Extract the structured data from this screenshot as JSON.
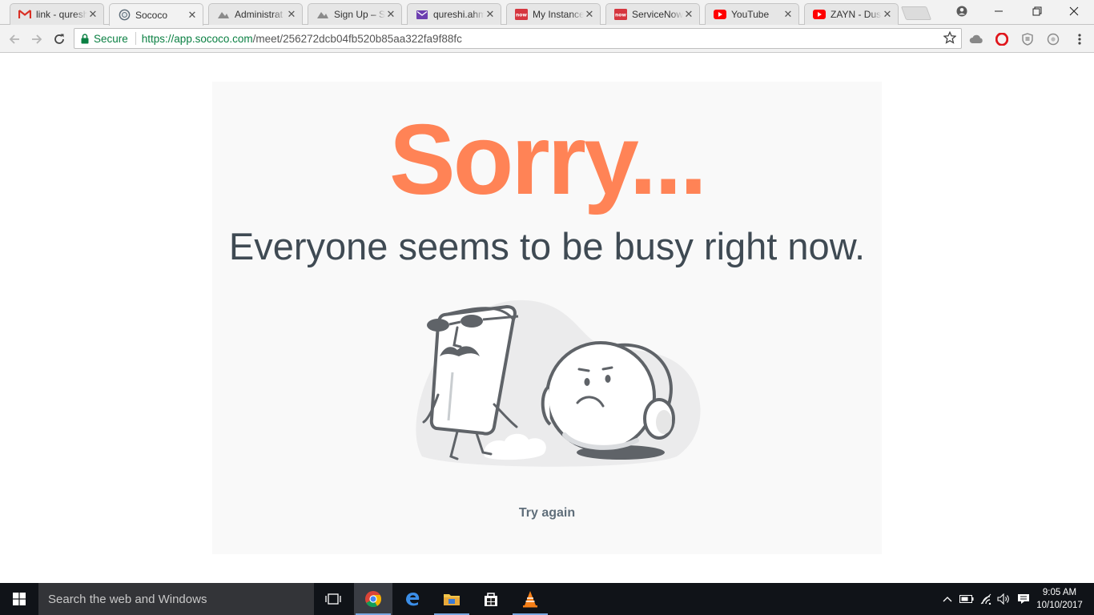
{
  "browser": {
    "tabs": [
      {
        "title": "link - quresh",
        "icon": "gmail-icon"
      },
      {
        "title": "Sococo",
        "icon": "sococo-icon",
        "active": true
      },
      {
        "title": "Administrat",
        "icon": "admin-icon"
      },
      {
        "title": "Sign Up – Sc",
        "icon": "signup-icon"
      },
      {
        "title": "qureshi.ahm",
        "icon": "mail-icon"
      },
      {
        "title": "My Instance",
        "icon": "servicenow-icon"
      },
      {
        "title": "ServiceNow",
        "icon": "servicenow-icon"
      },
      {
        "title": "YouTube",
        "icon": "youtube-icon"
      },
      {
        "title": "ZAYN - Dus",
        "icon": "youtube-icon"
      }
    ],
    "close_glyph": "✕",
    "secure_label": "Secure",
    "url_host": "https://app.sococo.com",
    "url_path": "/meet/256272dcb04fb520b85aa322fa9f88fc",
    "colors": {
      "secure": "#0b8043",
      "gmail": "#d93025",
      "servicenow": "#d6363f",
      "youtube": "#ff0000"
    }
  },
  "page": {
    "heading": "Sorry...",
    "subtitle": "Everyone seems to be busy right now.",
    "try_again": "Try again",
    "colors": {
      "heading": "#ff8356",
      "subtitle": "#3f4a53",
      "card": "#f9f9f9",
      "link": "#5f6e7a"
    }
  },
  "taskbar": {
    "search_placeholder": "Search the web and Windows",
    "time": "9:05 AM",
    "date": "10/10/2017",
    "apps": [
      "task-view-icon",
      "chrome-icon",
      "edge-icon",
      "file-explorer-icon",
      "store-icon",
      "vlc-icon"
    ]
  }
}
